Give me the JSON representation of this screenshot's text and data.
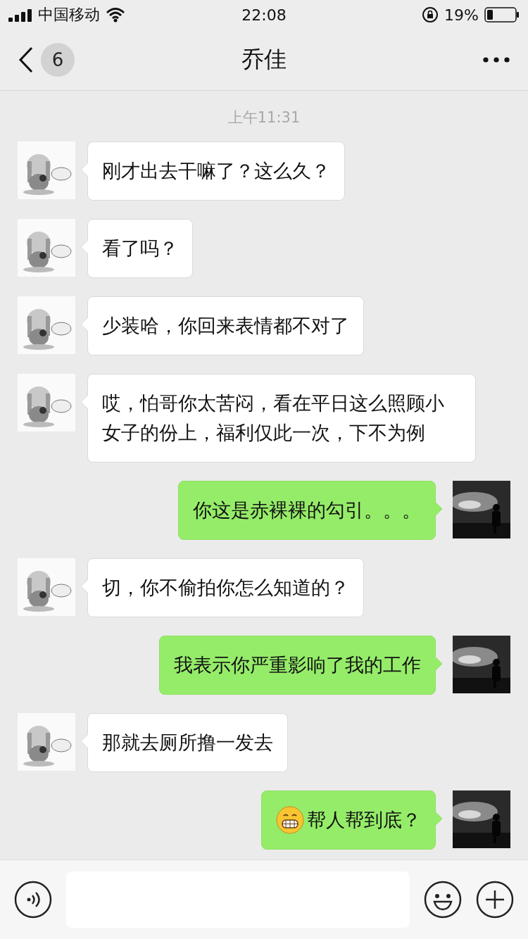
{
  "status_bar": {
    "carrier": "中国移动",
    "time": "22:08",
    "battery_text": "19%"
  },
  "nav": {
    "unread": "6",
    "title": "乔佳"
  },
  "chat": {
    "time_label": "上午11:31",
    "messages": [
      {
        "kind": "received",
        "emoji": false,
        "text": "刚才出去干嘛了？这么久？"
      },
      {
        "kind": "received",
        "emoji": false,
        "text": "看了吗？"
      },
      {
        "kind": "received",
        "emoji": false,
        "text": "少装哈，你回来表情都不对了"
      },
      {
        "kind": "received",
        "emoji": false,
        "text": "哎，怕哥你太苦闷，看在平日这么照顾小女子的份上，福利仅此一次，下不为例"
      },
      {
        "kind": "sent",
        "emoji": false,
        "text": "你这是赤裸裸的勾引。。。"
      },
      {
        "kind": "received",
        "emoji": false,
        "text": "切，你不偷拍你怎么知道的？"
      },
      {
        "kind": "sent",
        "emoji": false,
        "text": "我表示你严重影响了我的工作"
      },
      {
        "kind": "received",
        "emoji": false,
        "text": "那就去厕所撸一发去"
      },
      {
        "kind": "sent",
        "emoji": true,
        "text": "帮人帮到底？"
      }
    ]
  }
}
